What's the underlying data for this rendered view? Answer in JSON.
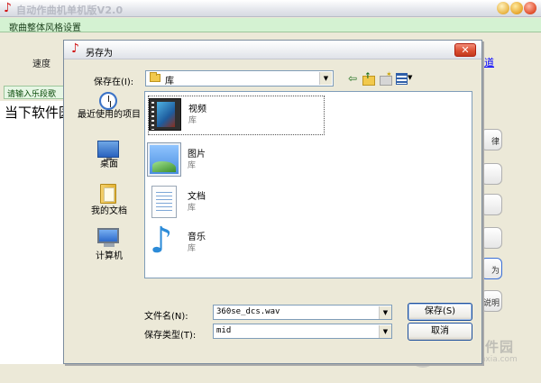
{
  "app": {
    "title": "自动作曲机单机版V2.0",
    "menu_item": "歌曲整体风格设置",
    "speed_label": "速度",
    "link_text": "道",
    "melody_label": "请输入乐段歌",
    "main_text": "当下软件园",
    "side_buttons": [
      "律",
      "",
      "",
      "",
      "为",
      "说明"
    ]
  },
  "dialog": {
    "title": "另存为",
    "close_glyph": "✕",
    "save_in_label": "保存在(I):",
    "save_in_value": "库",
    "places": [
      {
        "label": "最近使用的项目"
      },
      {
        "label": "桌面"
      },
      {
        "label": "我的文档"
      },
      {
        "label": "计算机"
      }
    ],
    "libraries": [
      {
        "name": "视频",
        "type": "库",
        "icon": "video-library-icon"
      },
      {
        "name": "图片",
        "type": "库",
        "icon": "picture-library-icon"
      },
      {
        "name": "文档",
        "type": "库",
        "icon": "document-library-icon"
      },
      {
        "name": "音乐",
        "type": "库",
        "icon": "music-library-icon"
      }
    ],
    "file_name_label": "文件名(N):",
    "file_name_value": "360se_dcs.wav",
    "file_type_label": "保存类型(T):",
    "file_type_value": "mid",
    "save_button": "保存(S)",
    "cancel_button": "取消"
  },
  "watermark": {
    "cn": "当下软件园",
    "en": "www.downxia.com"
  }
}
